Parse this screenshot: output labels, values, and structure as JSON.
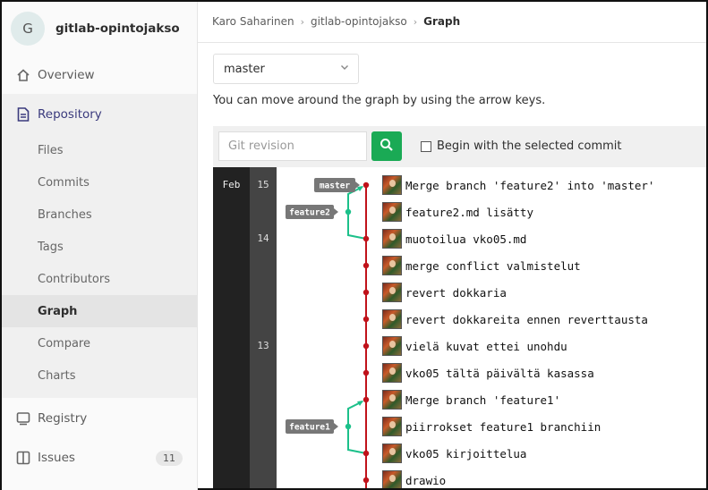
{
  "project": {
    "initial": "G",
    "name": "gitlab-opintojakso"
  },
  "nav": {
    "overview": "Overview",
    "repository": "Repository",
    "sub": [
      "Files",
      "Commits",
      "Branches",
      "Tags",
      "Contributors",
      "Graph",
      "Compare",
      "Charts"
    ],
    "registry": "Registry",
    "issues": "Issues",
    "issues_count": "11"
  },
  "breadcrumb": {
    "user": "Karo Saharinen",
    "project": "gitlab-opintojakso",
    "current": "Graph"
  },
  "branch_select": {
    "value": "master"
  },
  "hint": "You can move around the graph by using the arrow keys.",
  "toolbar": {
    "revision_placeholder": "Git revision",
    "begin_label": "Begin with the selected commit"
  },
  "graph": {
    "month": "Feb",
    "days": [
      "15",
      "14",
      "13"
    ],
    "labels": {
      "master": "master",
      "feature2": "feature2",
      "feature1": "feature1"
    },
    "commits": [
      "Merge branch 'feature2' into 'master'",
      "feature2.md lisätty",
      "muotoilua vko05.md",
      "merge conflict valmistelut",
      "revert dokkaria",
      "revert dokkareita ennen reverttausta",
      "vielä kuvat ettei unohdu",
      "vko05 tältä päivältä kasassa",
      "Merge branch 'feature1'",
      "piirrokset feature1 branchiin",
      "vko05 kirjoittelua",
      "drawio"
    ],
    "colors": {
      "main": "#c0121a",
      "branch": "#1cc08a",
      "tag": "#777777"
    }
  }
}
